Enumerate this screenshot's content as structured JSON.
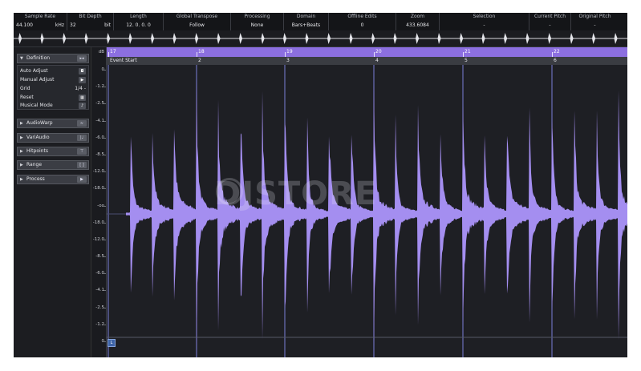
{
  "infobar": {
    "columns": [
      {
        "header": "Sample Rate",
        "value_left": "44.100",
        "value_right": "kHz"
      },
      {
        "header": "Bit Depth",
        "value_left": "32",
        "value_right": "bit"
      },
      {
        "header": "Length",
        "value": "12. 0. 0. 0"
      },
      {
        "header": "Global Transpose",
        "value": "Follow"
      },
      {
        "header": "Processing",
        "value": "None"
      },
      {
        "header": "Domain",
        "value": "Bars+Beats"
      },
      {
        "header": "Offline Edits",
        "value": "0"
      },
      {
        "header": "Zoom",
        "value": "433.6084"
      },
      {
        "header": "Selection",
        "value": "-"
      },
      {
        "header": "Current Pitch",
        "value": "-"
      },
      {
        "header": "Original Pitch",
        "value": "-"
      }
    ]
  },
  "inspector": {
    "definition": {
      "label": "Definition",
      "rows": [
        {
          "label": "Auto Adjust",
          "icon": "auto-adjust-icon"
        },
        {
          "label": "Manual Adjust",
          "icon": "manual-adjust-icon"
        },
        {
          "label": "Grid",
          "value": "1/4 -"
        },
        {
          "label": "Reset",
          "icon": "reset-icon"
        },
        {
          "label": "Musical Mode",
          "icon": "musical-mode-icon"
        }
      ]
    },
    "sections": [
      {
        "label": "AudioWarp",
        "icon": "audiowarp-icon"
      },
      {
        "label": "VariAudio",
        "icon": "variaudio-icon"
      },
      {
        "label": "Hitpoints",
        "icon": "hitpoints-icon"
      },
      {
        "label": "Range",
        "icon": "range-icon"
      },
      {
        "label": "Process",
        "icon": "process-icon"
      }
    ]
  },
  "db_ruler": {
    "unit": "dB",
    "labels": [
      "0",
      "-1.2",
      "-2.5",
      "-4.1",
      "-6.0",
      "-8.5",
      "-12.0",
      "-18.0",
      "-oo",
      "-18.0",
      "-12.0",
      "-8.5",
      "-6.0",
      "-4.1",
      "-2.5",
      "-1.2",
      "0"
    ]
  },
  "timeline": {
    "bars": [
      "17",
      "18",
      "19",
      "20",
      "21",
      "22"
    ],
    "events": [
      "Event Start",
      "2",
      "3",
      "4",
      "5",
      "6"
    ]
  },
  "watermark": "DJSTORE",
  "lock_label": "L",
  "colors": {
    "waveform": "#a48ef0",
    "timeline": "#8c6fe0",
    "background": "#1e1f24",
    "gridline": "#7a7fd8"
  }
}
